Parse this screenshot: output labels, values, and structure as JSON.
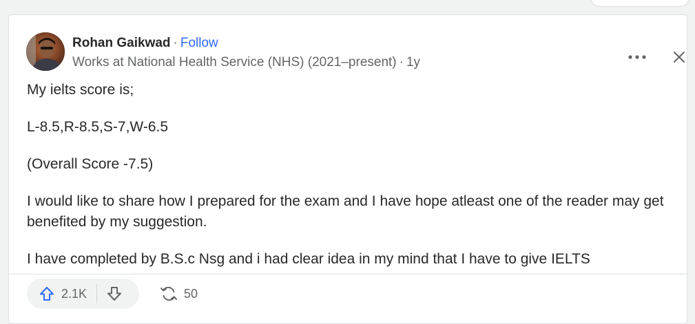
{
  "author": {
    "name": "Rohan Gaikwad",
    "separator": "·",
    "follow_label": "Follow",
    "credential": "Works at National Health Service (NHS) (2021–present)",
    "timestamp": "1y"
  },
  "content": {
    "paragraphs": [
      "My ielts score is;",
      "L-8.5,R-8.5,S-7,W-6.5",
      "(Overall Score -7.5)",
      "I would like to share how I prepared for the exam and I have hope atleast one of the reader may get benefited by my suggestion.",
      "I have completed by B.S.c Nsg and i had clear idea in my mind that I have to give IELTS"
    ]
  },
  "actions": {
    "upvote_count": "2.1K",
    "share_count": "50"
  },
  "colors": {
    "accent": "#2e69ff",
    "text": "#282829",
    "muted": "#636466"
  },
  "icons": {
    "more": "more-icon",
    "close": "close-icon",
    "upvote": "upvote-arrow-icon",
    "downvote": "downvote-arrow-icon",
    "share": "share-icon"
  }
}
